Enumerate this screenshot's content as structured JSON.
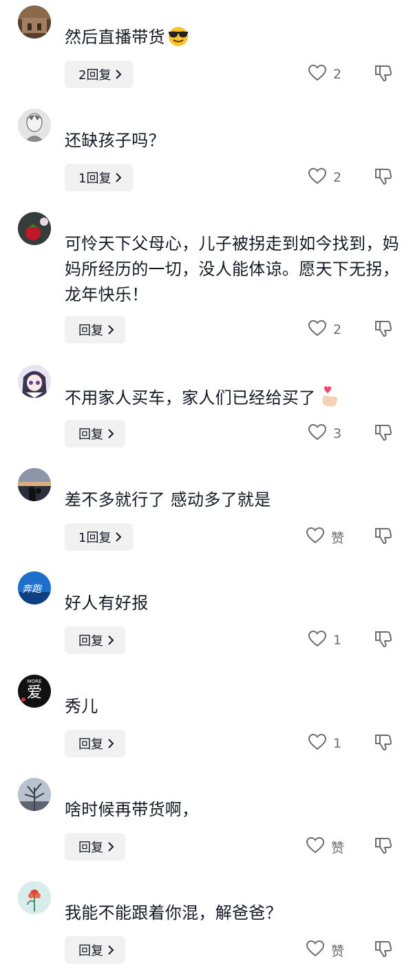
{
  "comments": [
    {
      "text": "然后直播带货",
      "emoji": "sunglasses-emoji",
      "reply_label": "2回复",
      "likes": "2"
    },
    {
      "text": "还缺孩子吗？",
      "reply_label": "1回复",
      "likes": "2"
    },
    {
      "text": "可怜天下父母心，儿子被拐走到如今找到，妈妈所经历的一切，没人能体谅。愿天下无拐，龙年快乐！",
      "reply_label": "回复",
      "likes": "2"
    },
    {
      "text": "不用家人买车，家人们已经给买了",
      "emoji": "finger-heart-emoji",
      "reply_label": "回复",
      "likes": "3"
    },
    {
      "text": "差不多就行了 感动多了就是",
      "reply_label": "1回复",
      "likes": "赞"
    },
    {
      "text": "好人有好报",
      "reply_label": "回复",
      "likes": "1"
    },
    {
      "text": "秀儿",
      "reply_label": "回复",
      "likes": "1"
    },
    {
      "text": "啥时候再带货啊，",
      "reply_label": "回复",
      "likes": "赞"
    },
    {
      "text": "我能不能跟着你混，解爸爸？",
      "reply_label": "回复",
      "likes": "赞"
    }
  ],
  "avatar_text": {
    "c6_line1": "奔跑",
    "c7_center": "爱",
    "c7_small": "MORE"
  },
  "icons": {
    "like": "heart-outline-icon",
    "dislike": "thumbs-down-icon",
    "chevron": "chevron-right-icon"
  },
  "colors": {
    "text": "#161823",
    "muted": "#6b6c70",
    "reply_bg": "#f1f1f2"
  }
}
